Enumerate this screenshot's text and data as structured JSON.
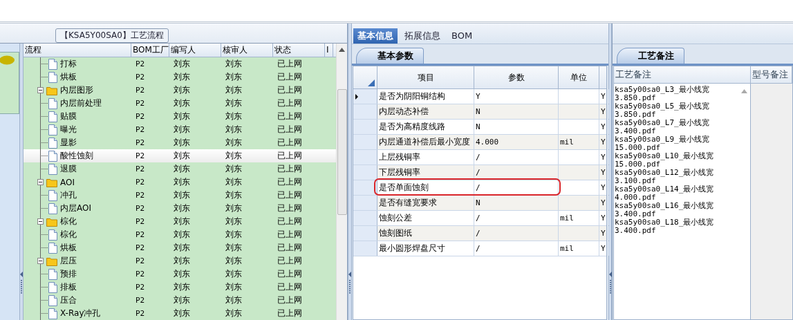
{
  "flow_panel": {
    "title": "【KSA5Y00SA0】工艺流程",
    "columns": [
      "流程",
      "BOM工厂",
      "编写人",
      "核审人",
      "状态",
      "I"
    ],
    "rows": [
      {
        "kind": "file",
        "name": "打标",
        "factory": "P2",
        "author": "刘东",
        "reviewer": "刘东",
        "status": "已上网",
        "selected": false
      },
      {
        "kind": "file",
        "name": "烘板",
        "factory": "P2",
        "author": "刘东",
        "reviewer": "刘东",
        "status": "已上网",
        "selected": false
      },
      {
        "kind": "folder",
        "name": "内层图形",
        "factory": "P2",
        "author": "刘东",
        "reviewer": "刘东",
        "status": "已上网",
        "selected": false,
        "expanded": true,
        "children": [
          {
            "kind": "file",
            "name": "内层前处理",
            "factory": "P2",
            "author": "刘东",
            "reviewer": "刘东",
            "status": "已上网",
            "selected": false
          },
          {
            "kind": "file",
            "name": "贴膜",
            "factory": "P2",
            "author": "刘东",
            "reviewer": "刘东",
            "status": "已上网",
            "selected": false
          },
          {
            "kind": "file",
            "name": "曝光",
            "factory": "P2",
            "author": "刘东",
            "reviewer": "刘东",
            "status": "已上网",
            "selected": false
          },
          {
            "kind": "file",
            "name": "显影",
            "factory": "P2",
            "author": "刘东",
            "reviewer": "刘东",
            "status": "已上网",
            "selected": false
          },
          {
            "kind": "file",
            "name": "酸性蚀刻",
            "factory": "P2",
            "author": "刘东",
            "reviewer": "刘东",
            "status": "已上网",
            "selected": true
          },
          {
            "kind": "file",
            "name": "退膜",
            "factory": "P2",
            "author": "刘东",
            "reviewer": "刘东",
            "status": "已上网",
            "selected": false
          }
        ]
      },
      {
        "kind": "folder",
        "name": "AOI",
        "factory": "P2",
        "author": "刘东",
        "reviewer": "刘东",
        "status": "已上网",
        "selected": false,
        "expanded": true,
        "children": [
          {
            "kind": "file",
            "name": "冲孔",
            "factory": "P2",
            "author": "刘东",
            "reviewer": "刘东",
            "status": "已上网",
            "selected": false
          },
          {
            "kind": "file",
            "name": "内层AOI",
            "factory": "P2",
            "author": "刘东",
            "reviewer": "刘东",
            "status": "已上网",
            "selected": false
          }
        ]
      },
      {
        "kind": "folder",
        "name": "棕化",
        "factory": "P2",
        "author": "刘东",
        "reviewer": "刘东",
        "status": "已上网",
        "selected": false,
        "expanded": true,
        "children": [
          {
            "kind": "file",
            "name": "棕化",
            "factory": "P2",
            "author": "刘东",
            "reviewer": "刘东",
            "status": "已上网",
            "selected": false
          },
          {
            "kind": "file",
            "name": "烘板",
            "factory": "P2",
            "author": "刘东",
            "reviewer": "刘东",
            "status": "已上网",
            "selected": false
          }
        ]
      },
      {
        "kind": "folder",
        "name": "层压",
        "factory": "P2",
        "author": "刘东",
        "reviewer": "刘东",
        "status": "已上网",
        "selected": false,
        "expanded": true,
        "children": [
          {
            "kind": "file",
            "name": "预排",
            "factory": "P2",
            "author": "刘东",
            "reviewer": "刘东",
            "status": "已上网",
            "selected": false
          },
          {
            "kind": "file",
            "name": "排板",
            "factory": "P2",
            "author": "刘东",
            "reviewer": "刘东",
            "status": "已上网",
            "selected": false
          },
          {
            "kind": "file",
            "name": "压合",
            "factory": "P2",
            "author": "刘东",
            "reviewer": "刘东",
            "status": "已上网",
            "selected": false
          },
          {
            "kind": "file",
            "name": "X-Ray冲孔",
            "factory": "P2",
            "author": "刘东",
            "reviewer": "刘东",
            "status": "已上网",
            "selected": false
          }
        ]
      }
    ]
  },
  "info_panel": {
    "tabs": [
      {
        "label": "基本信息",
        "selected": true
      },
      {
        "label": "拓展信息",
        "selected": false
      },
      {
        "label": "BOM",
        "selected": false
      }
    ],
    "subtab": "基本参数",
    "columns": [
      "项目",
      "参数",
      "单位"
    ],
    "rows": [
      {
        "item": "是否为阴阳铜结构",
        "value": "Y",
        "column_4": "Y",
        "current": true,
        "highlighted": false
      },
      {
        "item": "内层动态补偿",
        "value": "N",
        "column_4": "Y",
        "current": false,
        "highlighted": false
      },
      {
        "item": "是否为高精度线路",
        "value": "N",
        "column_4": "Y",
        "current": false,
        "highlighted": false
      },
      {
        "item": "内层通道补偿后最小宽度",
        "value": "4.000",
        "unit": "mil",
        "column_4": "Y",
        "current": false,
        "highlighted": false
      },
      {
        "item": "上层残铜率",
        "value": "/",
        "column_4": "Y",
        "current": false,
        "highlighted": false
      },
      {
        "item": "下层残铜率",
        "value": "/",
        "column_4": "Y",
        "current": false,
        "highlighted": false
      },
      {
        "item": "是否单面蚀刻",
        "value": "/",
        "column_4": "Y",
        "current": false,
        "highlighted": true
      },
      {
        "item": "是否有缝宽要求",
        "value": "N",
        "column_4": "Y",
        "current": false,
        "highlighted": false
      },
      {
        "item": "蚀刻公差",
        "value": "/",
        "unit": "mil",
        "column_4": "Y",
        "current": false,
        "highlighted": false
      },
      {
        "item": "蚀刻图纸",
        "value": "/",
        "column_4": "Y",
        "current": false,
        "highlighted": false
      },
      {
        "item": "最小圆形焊盘尺寸",
        "value": "/",
        "unit": "mil",
        "column_4": "Y",
        "current": false,
        "highlighted": false
      }
    ]
  },
  "remarks_panel": {
    "subtab": "工艺备注",
    "columns": [
      "工艺备注",
      "型号备注"
    ],
    "note_lines": [
      "ksa5y00sa0_L3_最小线宽",
      "3.850.pdf",
      "ksa5y00sa0_L5_最小线宽",
      "3.850.pdf",
      "ksa5y00sa0_L7_最小线宽",
      "3.400.pdf",
      "ksa5y00sa0_L9_最小线宽",
      "15.000.pdf",
      "ksa5y00sa0_L10_最小线宽",
      "15.000.pdf",
      "ksa5y00sa0_L12_最小线宽",
      "3.100.pdf",
      "ksa5y00sa0_L14_最小线宽",
      "4.000.pdf",
      "ksa5y00sa0_L16_最小线宽",
      "3.400.pdf",
      "ksa5y00sa0_L18_最小线宽",
      "3.400.pdf"
    ]
  }
}
